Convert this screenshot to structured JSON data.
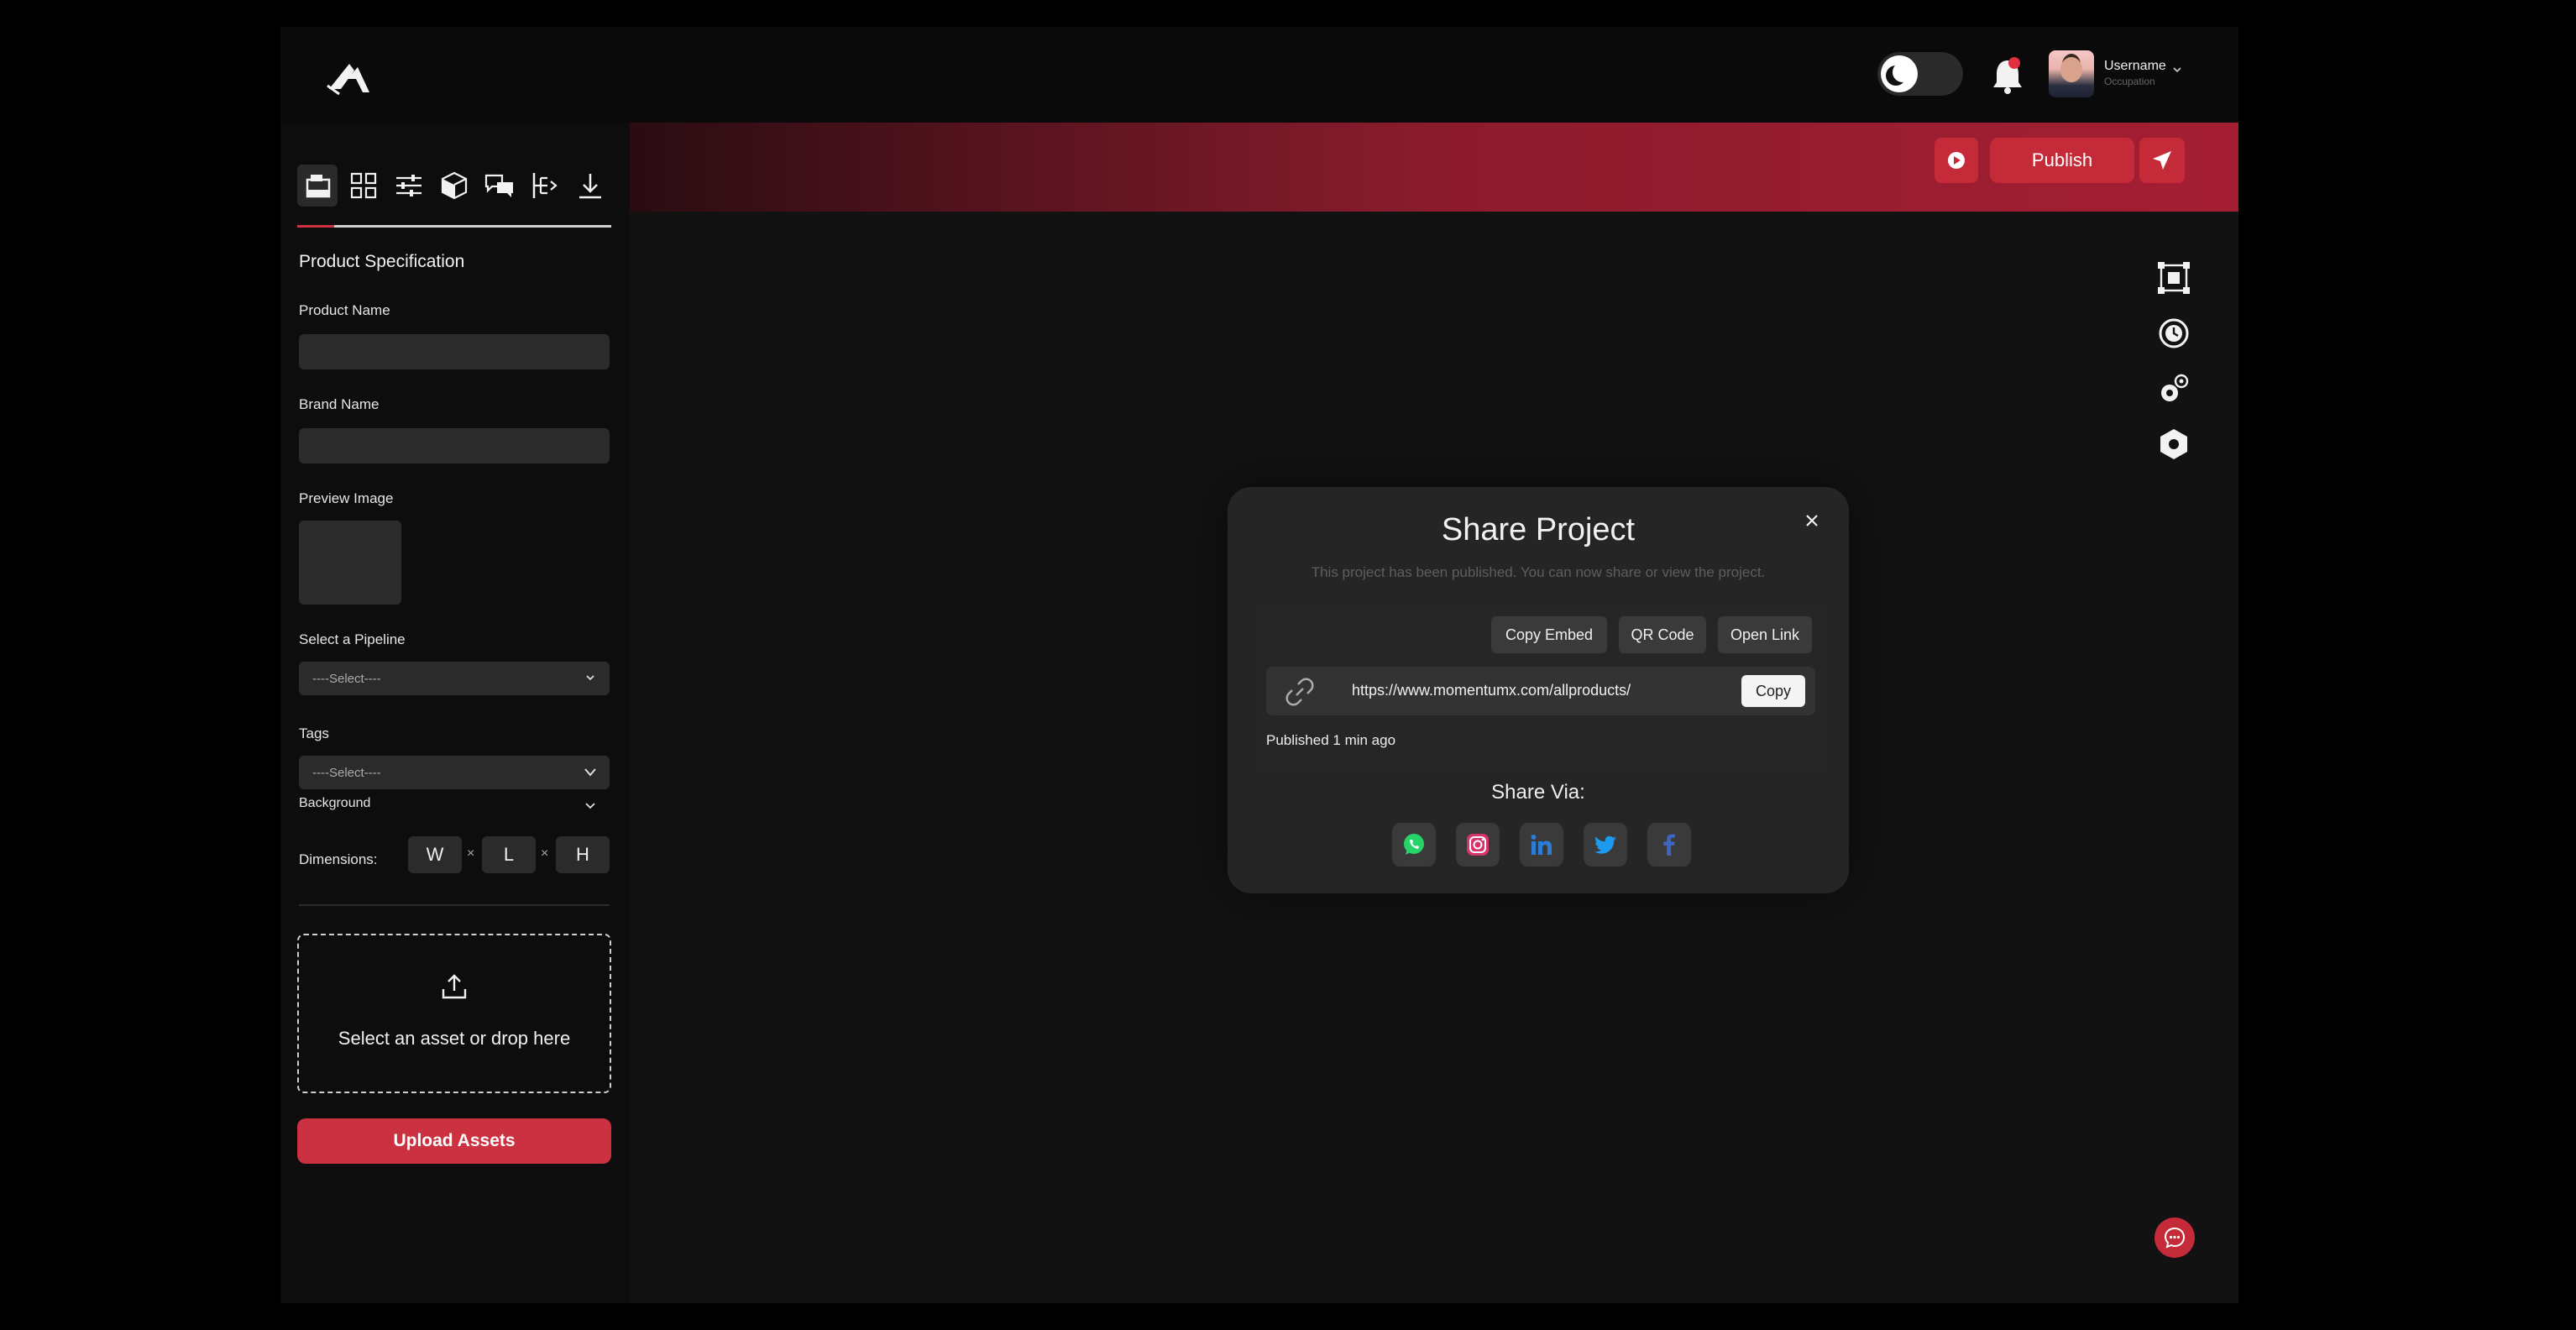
{
  "header": {
    "username": "Username",
    "occupation": "Occupation"
  },
  "panel": {
    "title": "Product Specification",
    "product_name_label": "Product Name",
    "brand_name_label": "Brand Name",
    "preview_image_label": "Preview Image",
    "pipeline_label": "Select a Pipeline",
    "pipeline_value": "----Select----",
    "tags_label": "Tags",
    "tags_value": "----Select----",
    "background_label": "Background",
    "dimensions_label": "Dimensions:",
    "dim_w": "W",
    "dim_l": "L",
    "dim_h": "H",
    "dim_sep": "×",
    "drop_text": "Select an asset or drop here",
    "upload_label": "Upload Assets"
  },
  "toolbar_icons": [
    "scene-icon",
    "grid-icon",
    "sliders-icon",
    "cube-icon",
    "chat-icon",
    "pipeline-icon",
    "download-icon"
  ],
  "actions": {
    "publish_label": "Publish"
  },
  "modal": {
    "title": "Share Project",
    "subtitle": "This project has been published. You can now share or view the project.",
    "copy_embed": "Copy Embed",
    "qr_code": "QR Code",
    "open_link": "Open Link",
    "url": "https://www.momentumx.com/allproducts/",
    "copy": "Copy",
    "published_text": "Published 1 min ago",
    "share_via": "Share Via:",
    "social": [
      "whatsapp-icon",
      "instagram-icon",
      "linkedin-icon",
      "twitter-icon",
      "facebook-icon"
    ]
  },
  "colors": {
    "accent": "#cb3140",
    "banner_dark": "#2a0c12",
    "banner_light": "#a41e33",
    "panel_bg": "#0d0d0d",
    "canvas_bg": "#121212",
    "modal_bg": "#252525"
  }
}
